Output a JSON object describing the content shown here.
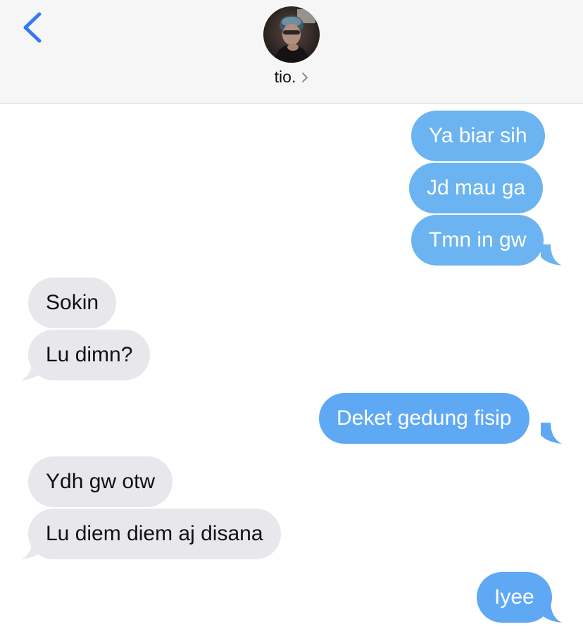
{
  "header": {
    "back_icon": "chevron-left-icon",
    "contact_name": "tio.",
    "contact_chevron_icon": "chevron-right-icon",
    "accent_color": "#3478f6"
  },
  "messages": [
    {
      "direction": "outgoing",
      "text": "Ya biar sih"
    },
    {
      "direction": "outgoing",
      "text": "Jd mau ga"
    },
    {
      "direction": "outgoing",
      "text": "Tmn in gw"
    },
    {
      "direction": "incoming",
      "text": "Sokin"
    },
    {
      "direction": "incoming",
      "text": "Lu dimn?"
    },
    {
      "direction": "outgoing",
      "text": "Deket gedung fisip"
    },
    {
      "direction": "incoming",
      "text": "Ydh gw otw"
    },
    {
      "direction": "incoming",
      "text": "Lu diem diem aj disana"
    },
    {
      "direction": "outgoing",
      "text": "Iyee"
    }
  ],
  "colors": {
    "outgoing_bubble": "#6cb4f1",
    "incoming_bubble": "#e7e7ec",
    "header_bg": "#f6f6f7"
  }
}
